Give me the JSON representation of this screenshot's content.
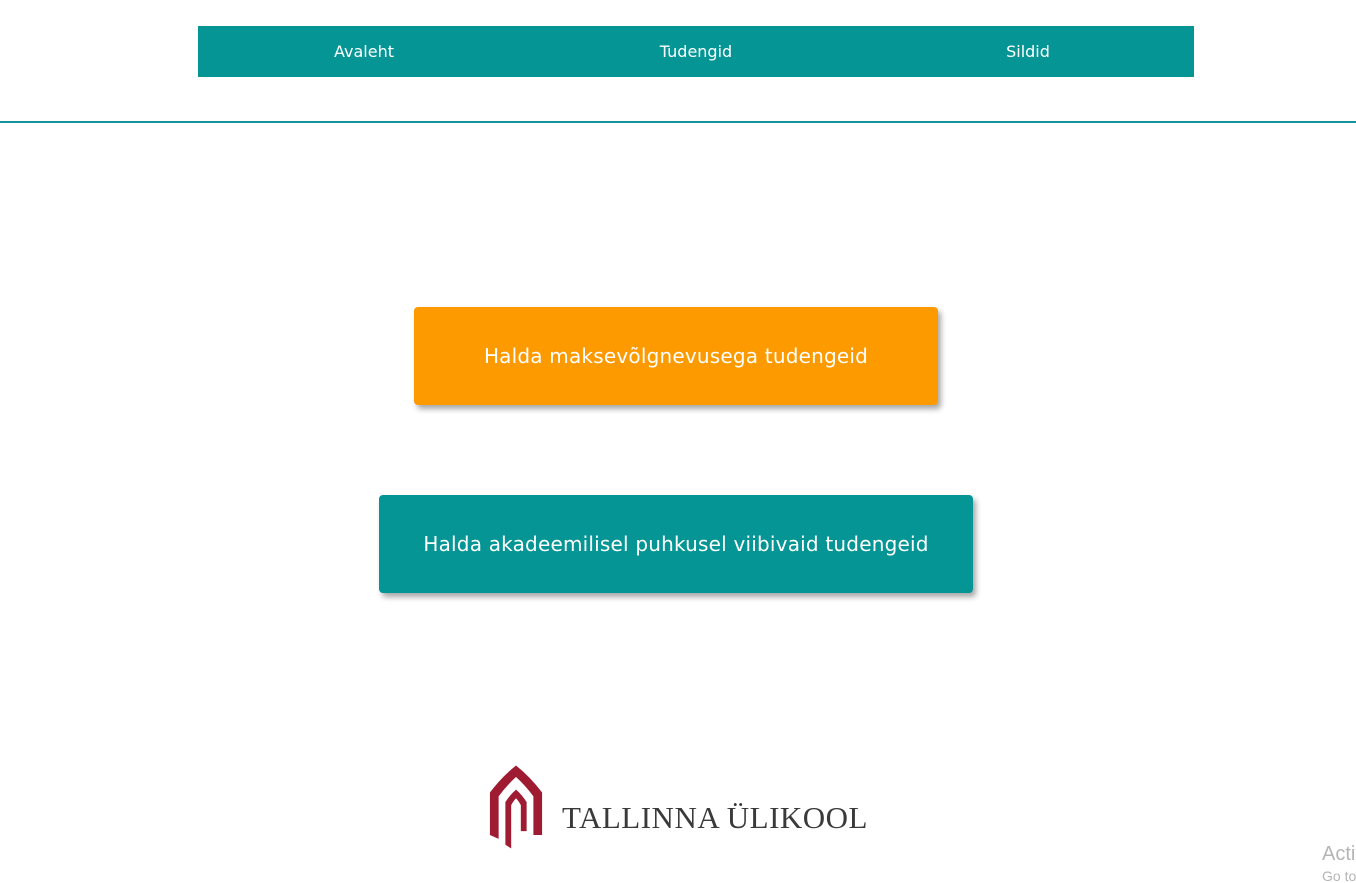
{
  "nav": {
    "items": [
      {
        "label": "Avaleht"
      },
      {
        "label": "Tudengid"
      },
      {
        "label": "Sildid"
      }
    ]
  },
  "main": {
    "debt_button_label": "Halda maksevõlgnevusega tudengeid",
    "leave_button_label": "Halda akadeemilisel puhkusel viibivaid tudengeid"
  },
  "footer": {
    "logo_text": "TALLINNA ÜLIKOOL"
  },
  "watermark": {
    "line1": "Acti",
    "line2": "Go to"
  },
  "colors": {
    "teal": "#069595",
    "orange": "#fd9a00",
    "logo_red": "#9e1b32"
  }
}
